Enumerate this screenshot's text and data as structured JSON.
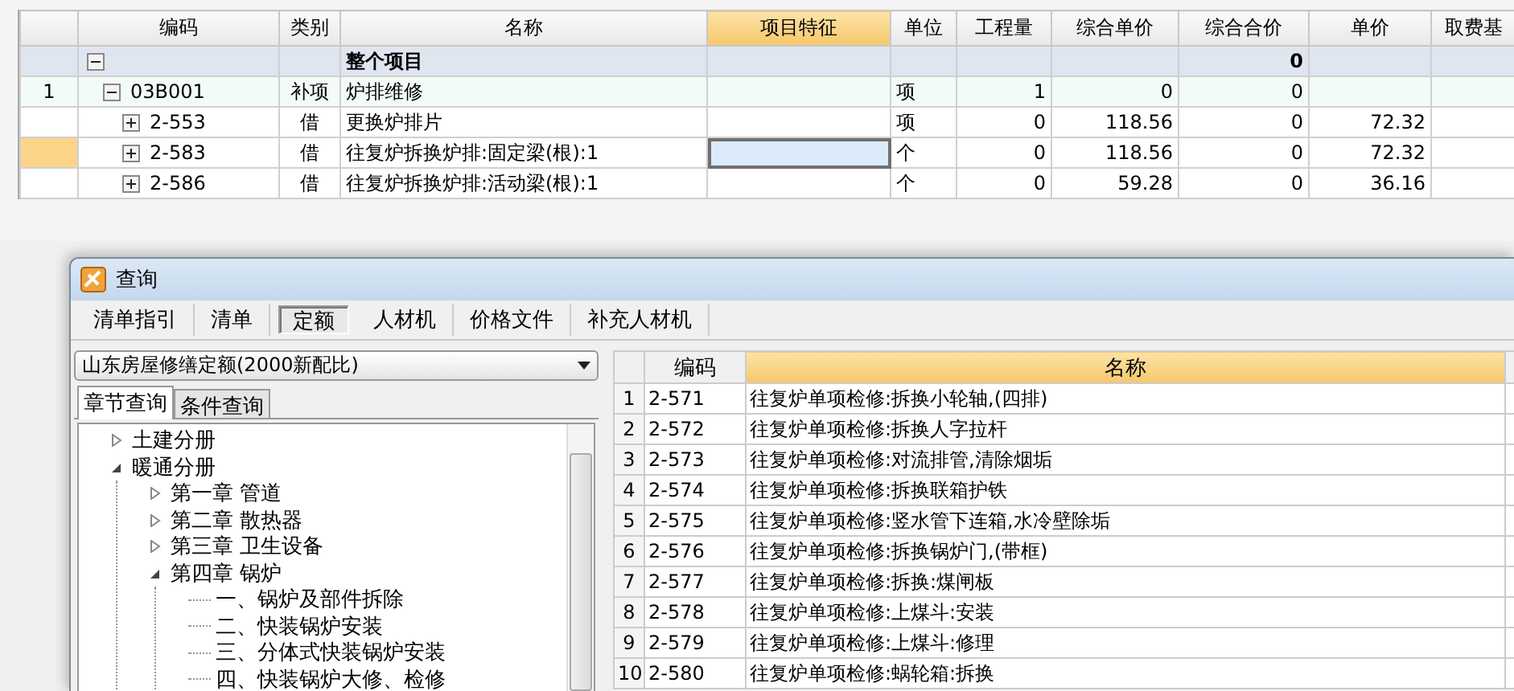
{
  "main_table": {
    "columns": [
      {
        "selected": false
      },
      {
        "label": "编码",
        "selected": false
      },
      {
        "label": "类别",
        "selected": false
      },
      {
        "label": "名称",
        "selected": false
      },
      {
        "label": "项目特征",
        "selected": true
      },
      {
        "label": "单位",
        "selected": false
      },
      {
        "label": "工程量",
        "selected": false
      },
      {
        "label": "综合单价",
        "selected": false
      },
      {
        "label": "综合合价",
        "selected": false
      },
      {
        "label": "单价",
        "selected": false
      },
      {
        "label": "取费基",
        "selected": false
      }
    ],
    "rows": [
      {
        "kind": "total",
        "row_number": "",
        "code": "",
        "type": "",
        "name": "整个项目",
        "feature": "",
        "unit": "",
        "quantity": "",
        "unit_price": "",
        "total_price": "0",
        "price": "",
        "expanded": true,
        "selected": false
      },
      {
        "kind": "item",
        "row_number": "1",
        "code": "03B001",
        "type": "补项",
        "name": "炉排维修",
        "feature": "",
        "unit": "项",
        "quantity": "1",
        "unit_price": "0",
        "total_price": "0",
        "price": "",
        "expanded": true,
        "selected": false
      },
      {
        "kind": "sub",
        "row_number": "",
        "code": "2-553",
        "type": "借",
        "name": "更换炉排片",
        "feature": "",
        "unit": "项",
        "quantity": "0",
        "unit_price": "118.56",
        "total_price": "0",
        "price": "72.32",
        "expanded": false,
        "selected": false
      },
      {
        "kind": "sub",
        "row_number": "",
        "code": "2-583",
        "type": "借",
        "name": "往复炉拆换炉排:固定梁(根):1",
        "feature": "",
        "unit": "个",
        "quantity": "0",
        "unit_price": "118.56",
        "total_price": "0",
        "price": "72.32",
        "expanded": false,
        "selected": true
      },
      {
        "kind": "sub",
        "row_number": "",
        "code": "2-586",
        "type": "借",
        "name": "往复炉拆换炉排:活动梁(根):1",
        "feature": "",
        "unit": "个",
        "quantity": "0",
        "unit_price": "59.28",
        "total_price": "0",
        "price": "36.16",
        "expanded": false,
        "selected": false
      }
    ]
  },
  "dialog": {
    "title": "查询",
    "tabs": [
      {
        "label": "清单指引",
        "selected": false
      },
      {
        "label": "清单",
        "selected": false
      },
      {
        "label": "定额",
        "selected": true
      },
      {
        "label": "人材机",
        "selected": false
      },
      {
        "label": "价格文件",
        "selected": false
      },
      {
        "label": "补充人材机",
        "selected": false
      }
    ],
    "quota_select": {
      "value": "山东房屋修缮定额(2000新配比)"
    },
    "subtabs": [
      {
        "label": "章节查询",
        "selected": true
      },
      {
        "label": "条件查询",
        "selected": false
      }
    ],
    "tree": [
      {
        "label": "土建分册",
        "expanded": false
      },
      {
        "label": "暖通分册",
        "expanded": true,
        "children": [
          {
            "label": "第一章 管道",
            "expanded": false
          },
          {
            "label": "第二章 散热器",
            "expanded": false
          },
          {
            "label": "第三章 卫生设备",
            "expanded": false
          },
          {
            "label": "第四章 锅炉",
            "expanded": true,
            "children": [
              {
                "label": "一、锅炉及部件拆除"
              },
              {
                "label": "二、快装锅炉安装"
              },
              {
                "label": "三、分体式快装锅炉安装"
              },
              {
                "label": "四、快装锅炉大修、检修"
              }
            ]
          }
        ]
      }
    ],
    "results": {
      "columns": [
        {
          "selected": false
        },
        {
          "label": "编码",
          "selected": false
        },
        {
          "label": "名称",
          "selected": true
        }
      ],
      "rows": [
        {
          "number": "1",
          "code": "2-571",
          "name": "往复炉单项检修:拆换小轮轴,(四排)"
        },
        {
          "number": "2",
          "code": "2-572",
          "name": "往复炉单项检修:拆换人字拉杆"
        },
        {
          "number": "3",
          "code": "2-573",
          "name": "往复炉单项检修:对流排管,清除烟垢"
        },
        {
          "number": "4",
          "code": "2-574",
          "name": "往复炉单项检修:拆换联箱护铁"
        },
        {
          "number": "5",
          "code": "2-575",
          "name": "往复炉单项检修:竖水管下连箱,水冷壁除垢"
        },
        {
          "number": "6",
          "code": "2-576",
          "name": "往复炉单项检修:拆换锅炉门,(带框)"
        },
        {
          "number": "7",
          "code": "2-577",
          "name": "往复炉单项检修:拆换:煤闸板"
        },
        {
          "number": "8",
          "code": "2-578",
          "name": "往复炉单项检修:上煤斗:安装"
        },
        {
          "number": "9",
          "code": "2-579",
          "name": "往复炉单项检修:上煤斗:修理"
        },
        {
          "number": "10",
          "code": "2-580",
          "name": "往复炉单项检修:蜗轮箱:拆换"
        }
      ]
    }
  }
}
